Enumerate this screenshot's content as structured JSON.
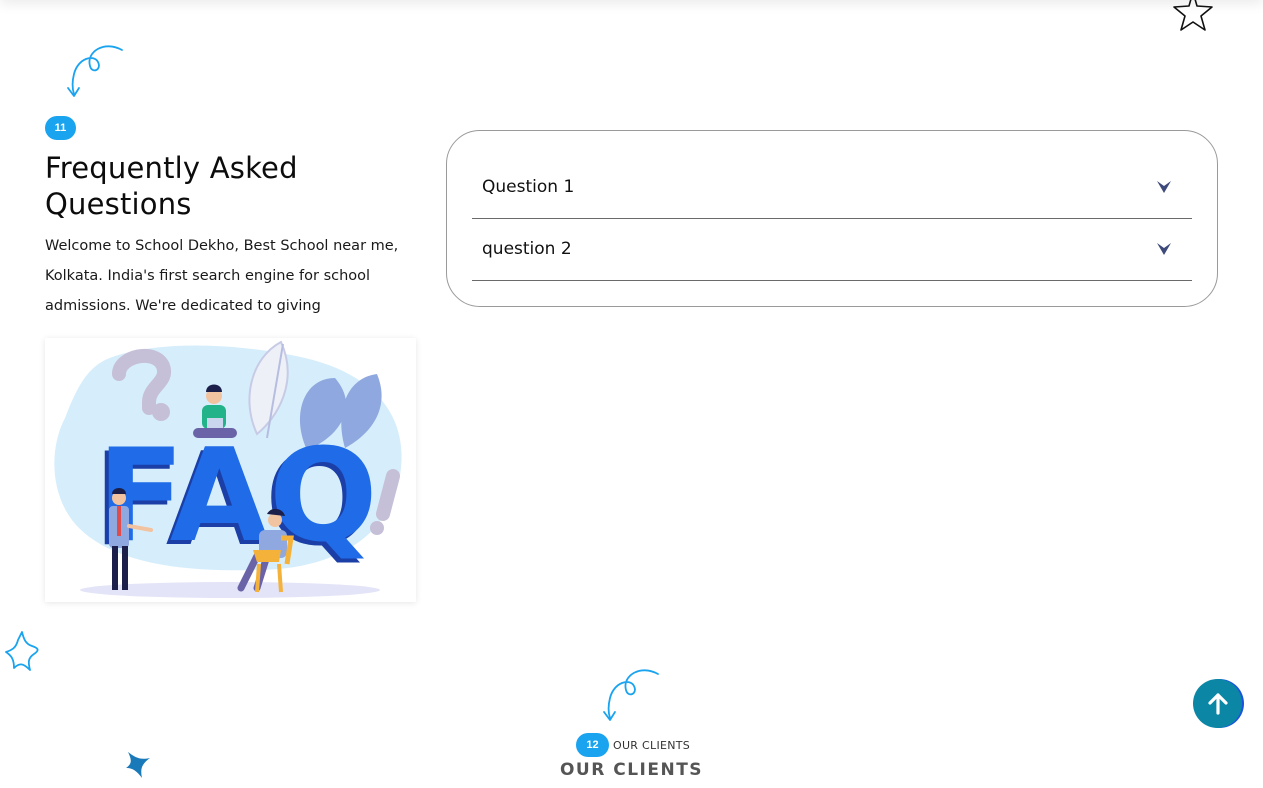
{
  "faq": {
    "badge": "11",
    "title_line1": "Frequently Asked",
    "title_line2": "Questions",
    "desc_line1": "Welcome to School Dekho, Best School near me,",
    "desc_line2": "Kolkata. India's first search engine for school",
    "desc_line3": "admissions. We're dedicated to giving",
    "illustration_text": "FAQ",
    "questions": [
      {
        "label": "Question 1"
      },
      {
        "label": "question 2"
      }
    ]
  },
  "clients": {
    "badge": "12",
    "small_label": "OUR CLIENTS",
    "title": "OUR CLIENTS"
  },
  "colors": {
    "accent": "#1aa3ef",
    "scroll_top": "#0b87a5",
    "chevron": "#3d4a7a",
    "faq_blue": "#1f6be8"
  },
  "icons": {
    "scroll_top": "arrow-up-icon",
    "chevron": "chevron-down-icon",
    "decor_arrow": "curly-arrow-icon",
    "decor_star": "star-outline-icon",
    "decor_sparkle": "sparkle-icon"
  }
}
